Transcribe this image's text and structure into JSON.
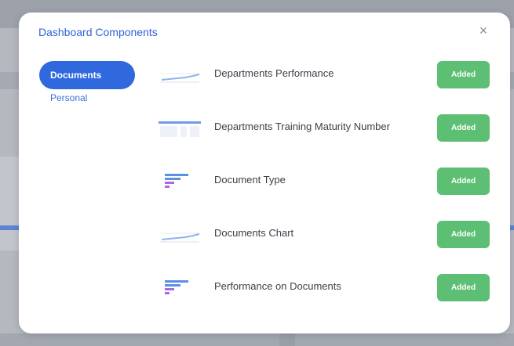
{
  "modal": {
    "title": "Dashboard Components",
    "close_icon": "×"
  },
  "nav": {
    "items": [
      {
        "label": "Documents",
        "active": true
      },
      {
        "label": "Personal",
        "active": false
      }
    ]
  },
  "components": [
    {
      "label": "Departments Performance",
      "thumb": "line-chart-thumbnail-icon",
      "button": "Added"
    },
    {
      "label": "Departments Training Maturity Number",
      "thumb": "bar-table-thumbnail-icon",
      "button": "Added"
    },
    {
      "label": "Document Type",
      "thumb": "horizontal-bar-thumbnail-icon",
      "button": "Added"
    },
    {
      "label": "Documents Chart",
      "thumb": "line-chart-thumbnail-icon",
      "button": "Added"
    },
    {
      "label": "Performance on Documents",
      "thumb": "horizontal-bar-thumbnail-icon",
      "button": "Added"
    }
  ],
  "colors": {
    "accent": "#2f69dd",
    "added": "#5cbf73",
    "title": "#2f63d6"
  }
}
